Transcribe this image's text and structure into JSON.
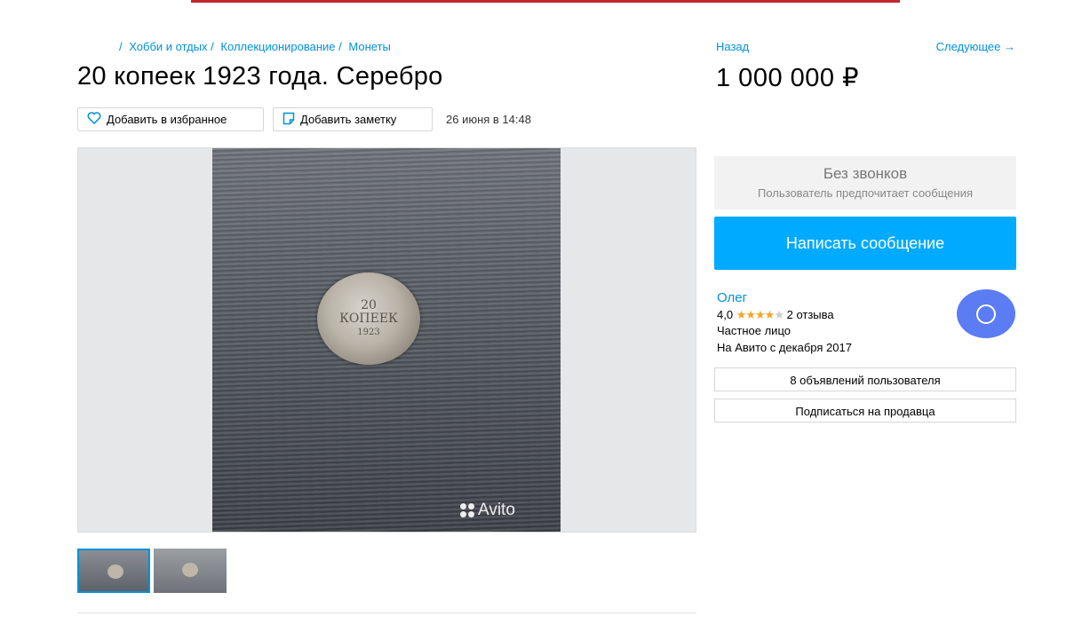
{
  "breadcrumb": {
    "sep": "/",
    "items": [
      "Хобби и отдых",
      "Коллекционирование",
      "Монеты"
    ]
  },
  "nav": {
    "back": "Назад",
    "next": "Следующее →"
  },
  "listing": {
    "title": "20 копеек 1923 года. Серебро",
    "price": "1 000 000 ₽",
    "date": "26 июня в 14:48"
  },
  "actions": {
    "favorite": "Добавить в избранное",
    "note": "Добавить заметку"
  },
  "photo": {
    "watermark": "Avito",
    "coin_line1": "20",
    "coin_line2": "КОПЕЕК",
    "coin_line3": "1923"
  },
  "contact": {
    "no_calls_title": "Без звонков",
    "no_calls_subtitle": "Пользователь предпочитает сообщения",
    "message_button": "Написать сообщение"
  },
  "seller": {
    "name": "Олег",
    "rating": "4,0",
    "rating_value": 4,
    "reviews": "2 отзыва",
    "type": "Частное лицо",
    "since": "На Авито с декабря 2017",
    "listings_button": "8 объявлений пользователя",
    "subscribe_button": "Подписаться на продавца"
  },
  "colors": {
    "accent": "#00aaff",
    "link": "#0091d9",
    "avatar": "#5b7cf3",
    "topbar": "#c1272d"
  }
}
